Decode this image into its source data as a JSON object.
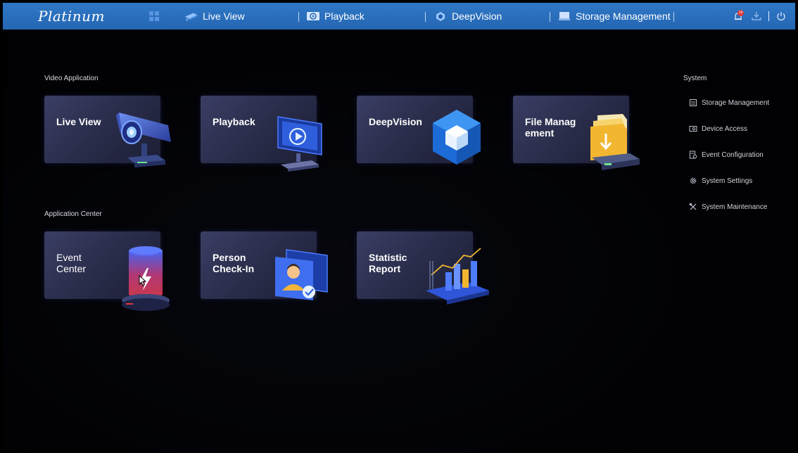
{
  "topbar": {
    "logo": "Platinum",
    "nav": [
      {
        "label": "Live View",
        "icon": "camera-icon"
      },
      {
        "label": "Playback",
        "icon": "playback-icon"
      },
      {
        "label": "DeepVision",
        "icon": "deepvision-icon"
      },
      {
        "label": "Storage Management",
        "icon": "storage-icon"
      }
    ],
    "alarm_badge": "14"
  },
  "sections": {
    "video": "Video Application",
    "app_center": "Application Center",
    "system": "System"
  },
  "video_apps": [
    {
      "label": "Live View"
    },
    {
      "label": "Playback"
    },
    {
      "label": "DeepVision"
    },
    {
      "label": "File Manag\nement"
    }
  ],
  "center_apps": [
    {
      "label": "Event\nCenter"
    },
    {
      "label": "Person\nCheck-In"
    },
    {
      "label": "Statistic\nReport"
    }
  ],
  "system_items": [
    {
      "label": "Storage Management",
      "icon": "storage-management-icon"
    },
    {
      "label": "Device Access",
      "icon": "device-access-icon"
    },
    {
      "label": "Event Configuration",
      "icon": "event-configuration-icon"
    },
    {
      "label": "System Settings",
      "icon": "gear-icon"
    },
    {
      "label": "System Maintenance",
      "icon": "tools-icon"
    }
  ],
  "colors": {
    "topbar": "#2566b3",
    "background": "#000000",
    "card": "#2b2e4c",
    "alarm": "#e53935"
  }
}
